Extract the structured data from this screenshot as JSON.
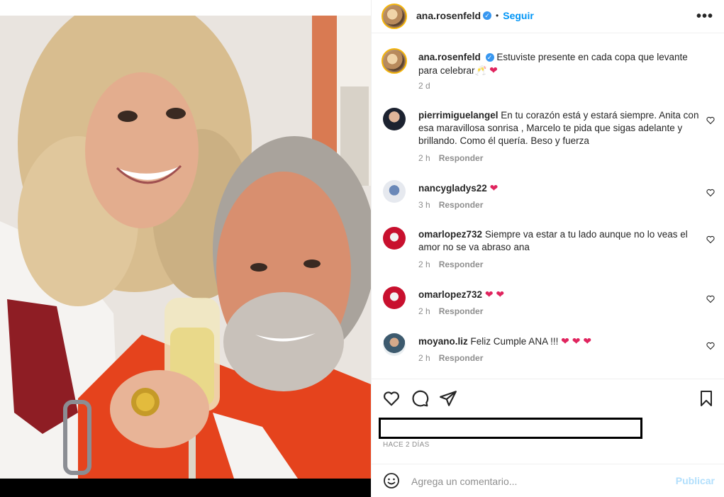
{
  "post": {
    "author": "ana.rosenfeld",
    "follow_label": "Seguir",
    "dot": "•",
    "more_label": "•••",
    "verified_mark": "✓",
    "caption_text": "Estuviste presente en cada copa que levante para celebrar🥂",
    "caption_age": "2 d",
    "time_ago": "HACE 2 DÍAS",
    "likes_text": ""
  },
  "comments": [
    {
      "user": "pierrimiguelangel",
      "text": "En tu corazón está y estará siempre. Anita con esa maravillosa sonrisa , Marcelo te pida que sigas adelante y brillando. Como él quería. Beso y fuerza",
      "age": "2 h",
      "reply": "Responder",
      "hearts": ""
    },
    {
      "user": "nancygladys22",
      "text": "",
      "age": "3 h",
      "reply": "Responder",
      "hearts": "❤"
    },
    {
      "user": "omarlopez732",
      "text": "Siempre va estar a tu lado aunque no lo veas el amor no se va abraso ana",
      "age": "2 h",
      "reply": "Responder",
      "hearts": ""
    },
    {
      "user": "omarlopez732",
      "text": "",
      "age": "2 h",
      "reply": "Responder",
      "hearts": "❤ ❤"
    },
    {
      "user": "moyano.liz",
      "text": "Feliz Cumple ANA !!!",
      "age": "2 h",
      "reply": "Responder",
      "hearts": "❤ ❤ ❤"
    }
  ],
  "comment_box": {
    "placeholder": "Agrega un comentario...",
    "publish_label": "Publicar"
  },
  "icons": {
    "like": "heart-outline-icon",
    "comment": "speech-bubble-icon",
    "share": "paper-plane-icon",
    "save": "bookmark-icon",
    "emoji": "smiley-icon"
  },
  "colors": {
    "accent": "#0095f6",
    "heart": "#e0245e",
    "muted": "#8e8e8e",
    "publish_disabled": "#b2dffc"
  }
}
